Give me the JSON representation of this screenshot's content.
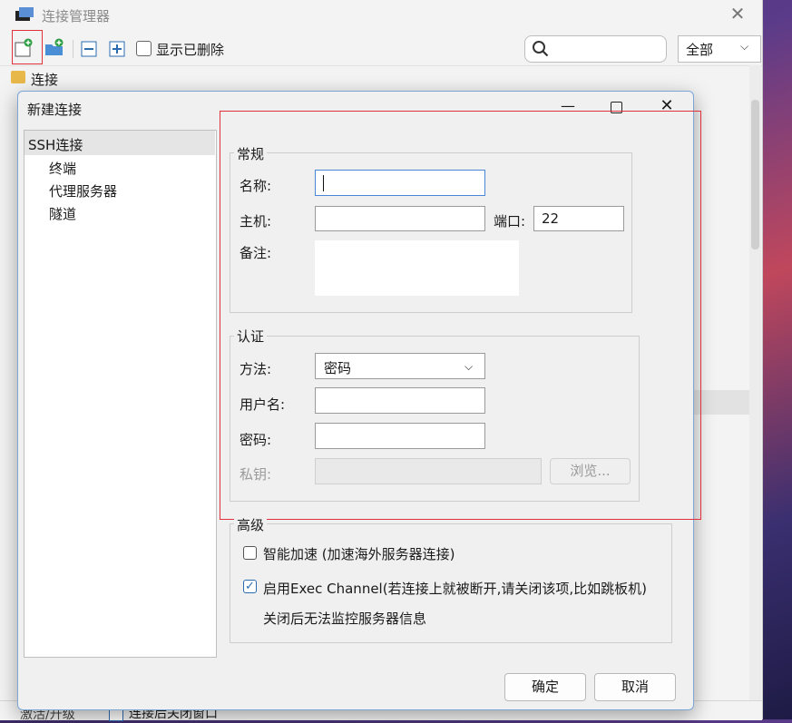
{
  "manager": {
    "title": "连接管理器",
    "close_glyph": "✕",
    "toolbar": {
      "show_deleted_label": "显示已删除",
      "filter_value": "全部",
      "filter_chevron": "⌵",
      "icons": [
        "new-connection-icon",
        "new-folder-icon",
        "collapse-icon",
        "expand-icon"
      ]
    },
    "tree_root_label": "连接",
    "bottom": {
      "activate_label": "激活/升级",
      "close_after_label": "连接后关闭窗口"
    }
  },
  "dialog": {
    "title": "新建连接",
    "min_glyph": "—",
    "close_glyph": "✕",
    "nav": {
      "root": "SSH连接",
      "children": [
        "终端",
        "代理服务器",
        "隧道"
      ]
    },
    "general": {
      "title": "常规",
      "name_label": "名称:",
      "name_value": "",
      "host_label": "主机:",
      "host_value": "",
      "port_label": "端口:",
      "port_value": "22",
      "note_label": "备注:",
      "note_value": ""
    },
    "auth": {
      "title": "认证",
      "method_label": "方法:",
      "method_value": "密码",
      "method_chevron": "⌵",
      "username_label": "用户名:",
      "username_value": "",
      "password_label": "密码:",
      "password_value": "",
      "privkey_label": "私钥:",
      "privkey_value": "",
      "browse_label": "浏览..."
    },
    "advanced": {
      "title": "高级",
      "smart_accel_label": "智能加速 (加速海外服务器连接)",
      "smart_accel_checked": false,
      "exec_channel_label": "启用Exec Channel(若连接上就被断开,请关闭该项,比如跳板机)",
      "exec_channel_checked": true,
      "check_glyph": "✓",
      "exec_channel_note": "关闭后无法监控服务器信息"
    },
    "ok_label": "确定",
    "cancel_label": "取消"
  },
  "colors": {
    "highlight_red": "#e0303a",
    "accent_blue": "#2b6cb0",
    "folder_yellow": "#e8b84a"
  }
}
